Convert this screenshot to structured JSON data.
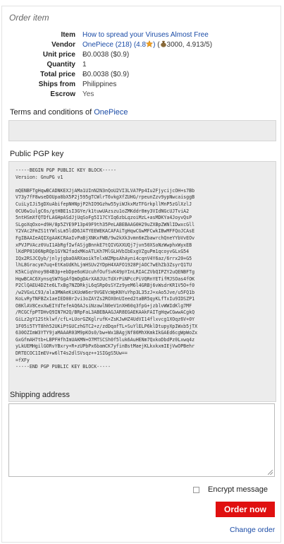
{
  "heading": "Order item",
  "details": {
    "item_label": "Item",
    "item_value": "How to spread your Viruses Almost Free",
    "vendor_label": "Vendor",
    "vendor_name": "OnePiece (218)",
    "vendor_rating_open": "(4.8",
    "vendor_rating_close": ")",
    "vendor_bag_open": "(",
    "vendor_stats": "3000, 4.913/5)",
    "unit_price_label": "Unit price",
    "unit_price_value": "Ƀ0.0038 ($0.9)",
    "quantity_label": "Quantity",
    "quantity_value": "1",
    "total_price_label": "Total price",
    "total_price_value": "Ƀ0.0038 ($0.9)",
    "ships_from_label": "Ships from",
    "ships_from_value": "Philippines",
    "escrow_label": "Escrow",
    "escrow_value": "Yes"
  },
  "terms": {
    "title_prefix": "Terms and conditions of",
    "vendor": "OnePiece",
    "text": ""
  },
  "pgp": {
    "title": "Public PGP key",
    "key": "-----BEGIN PGP PUBLIC KEY BLOCK-----\nVersion: GnuPG v1\n\nmQENBFTgHqwBCADNKEXJjAMa1UInN2N3nQoU2VI3LVA7Pp4Iu2FjycijcOH+s7Bb\nV73y7fF8wseDOUpa8bX5P2j595gTCWlrT6vkgXfZUHG/rpeunZzv9ypNwcaisggB\nCuiLyIJi5gDXuAbifepNHNpjP2hIO9Gzhw55yiWJkxMzTFGrkpllMnP5zGlXzlJ\n0CU6w1ulgC6s/gtHBE1sI3GYe/k1tuwUAzszu1oZMKddr8my3VIdNGcUJTviA2\n5ntHSmXfQTDfLAGHpASdJjUqSoFg5I17CYIq6zbLqzoiMzL+asMDKYa4JoyvQsP\nSLgoXqOxo+d9H/8p5ZYE9P13p49F9th35PeLABEBAAG0H29uZXBpZWNlIDwxcGll\nY2VAc2FmZS1tYWlsLm5ldD6JATYEEWEKACAFAiTgHqwCGwMFCwkIBwMFFQoJCAsE\nFgIBAAIeAQIXgAAKCRAaIvPaBjXNKxFWB/9w2kXk3vmn6mZbawrchQneYYbVvEOv\nxPVJPVAcz0VuI1AbRgfIwfASjgBnnkE7tQIVGXXUQj7jvn50XSoNzWwphxWyxEB\nlKdPP8106NpRQp1GYN2fadxMKoATLKh7MlGLHVbIbExgVZguPm1qcoyvGLxG54\nIQx2RSJCQyb/jnlyjgbaOARXaoikTelxWZMpsAhAyni4cqnV4Y6az/6rrx20+G5\nlhL8Gracym7uq+EtKaUdKhLjmHSUv2YDpH4XAFO1928PjAOC7wEhZb3ZsyrQ1TU\nK5kCiqVnoy984B3p+ebDpe6oKUcuhfOufSvK49pYInLRIACZVbQIPZY2uQENBFTg\nHqwBCAC6XynsqSW7GgAfQmDgDArXA8JUcTdXrPiNPccPiVQRnYETifMJSOas4fOK\nP2ClQAEU4DZte6LTxBg7NZDRkjL6qSRp0sSYZz9yeM6l4GRBj6vWsdrKR1V5O+f0\n/w2VGxLC93/ala3MWAeKiKUoW6er9VGEVcWpKNYuYhp3L35zJ+xAo5Jve/u5FQ1b\nKoLvRyTNFBZx1aeIED08r2vi3oZAYZs2ROX0nUIeed2taBR5qyKLfTxIu9IDSZP1\nO8KlAV8CexXwEIYdTefeAQ6AJsiNzawlN0eV1nXH60q3fpG+jzblvWWIdKlg7MF\n/RCGCfpPTDHvQ9IN7H2Q/BRpFaL3ABEBAAGJAR8EGAEKAAkFAITgHqwCGwwACgkQ\nGiLz2gY12Stklwf/cfL+LUorGZKglrufK+ZsKJwHZ4UdVI14flxvcg1XOqz6V+0Y\n1F05i5TYT8hh52UKiPtGUCzhGTC2+z/zdDqafTL+SuYlELP6klDtupyXpIWxb5jTX\n630OZImW3YTY9jaMAAAR03M9pKOs0/bw+Wx1BAgjNf86MhXKmkIkGAEd6cgWpWoZx\nGxGfmAH7tb+LBPFHfhImUAKMN+O7MTSCSh0f5luk6AuHENm7QxkoDbdPz0Lxwq4z\nyLkUEMHgilGORvYBxry+R+zUPbPx6bamCK7yfinBstMaejKLkxkxmIEjVwOPBehr\nDRTECOC1ImEV+w6lT4s2dlSVsqz++1SIGgS5Uw==\n=fXFy\n-----END PGP PUBLIC KEY BLOCK-----"
  },
  "shipping": {
    "title": "Shipping address",
    "value": "",
    "placeholder": ""
  },
  "encrypt_label": "Encrypt message",
  "order_button": "Order now",
  "change_link": "Change order",
  "colors": {
    "link": "#1a4ba6",
    "order_button": "#e01010",
    "box_bg": "#ececec"
  }
}
